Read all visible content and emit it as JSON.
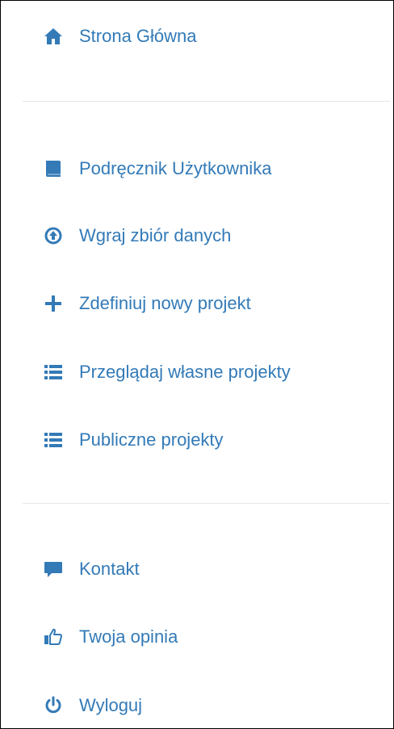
{
  "theme": {
    "link_color": "#337ab7"
  },
  "menu": {
    "items": [
      {
        "label": "Strona Główna",
        "icon": "home-icon"
      },
      {
        "label": "Podręcznik Użytkownika",
        "icon": "book-icon"
      },
      {
        "label": "Wgraj zbiór danych",
        "icon": "upload-circle-icon"
      },
      {
        "label": "Zdefiniuj nowy projekt",
        "icon": "plus-icon"
      },
      {
        "label": "Przeglądaj własne projekty",
        "icon": "list-icon"
      },
      {
        "label": "Publiczne projekty",
        "icon": "list-icon"
      },
      {
        "label": "Kontakt",
        "icon": "comment-icon"
      },
      {
        "label": "Twoja opinia",
        "icon": "thumbs-up-icon"
      },
      {
        "label": "Wyloguj",
        "icon": "power-icon"
      }
    ]
  }
}
